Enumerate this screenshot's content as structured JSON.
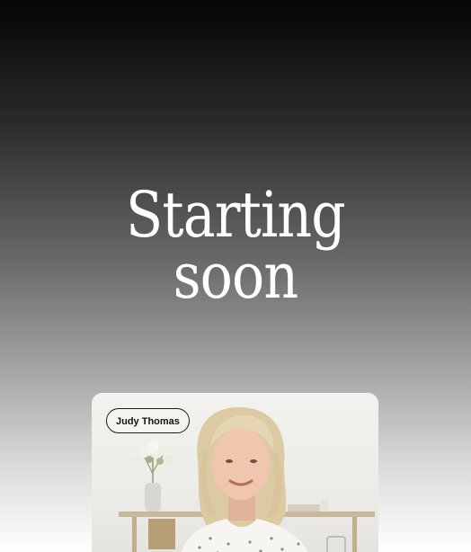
{
  "headline": {
    "line1": "Starting",
    "line2": "soon"
  },
  "participant": {
    "name": "Judy Thomas"
  },
  "colors": {
    "gradient_top": "#050505",
    "gradient_bottom": "#ffffff",
    "headline_text": "#ffffff",
    "chip_border": "#1a1a1a"
  }
}
